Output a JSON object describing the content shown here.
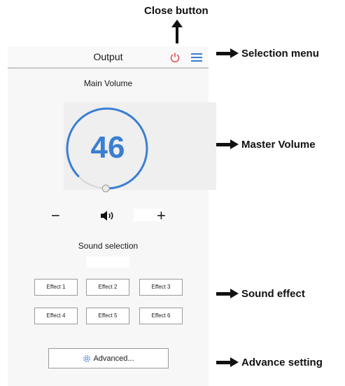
{
  "annotations": {
    "close_button": "Close button",
    "selection_menu": "Selection menu",
    "master_volume": "Master Volume",
    "sound_effect": "Sound effect",
    "advance_setting": "Advance setting"
  },
  "header": {
    "title": "Output"
  },
  "volume": {
    "label": "Main Volume",
    "value": "46",
    "level": 0.46
  },
  "controls": {
    "minus": "−",
    "plus": "+"
  },
  "sound": {
    "label": "Sound selection"
  },
  "effects": [
    "Effect 1",
    "Effect 2",
    "Effect 3",
    "Effect 4",
    "Effect 5",
    "Effect 6"
  ],
  "advanced": {
    "label": "Advanced..."
  },
  "colors": {
    "accent": "#3a7fd1",
    "power": "#e0555a"
  }
}
